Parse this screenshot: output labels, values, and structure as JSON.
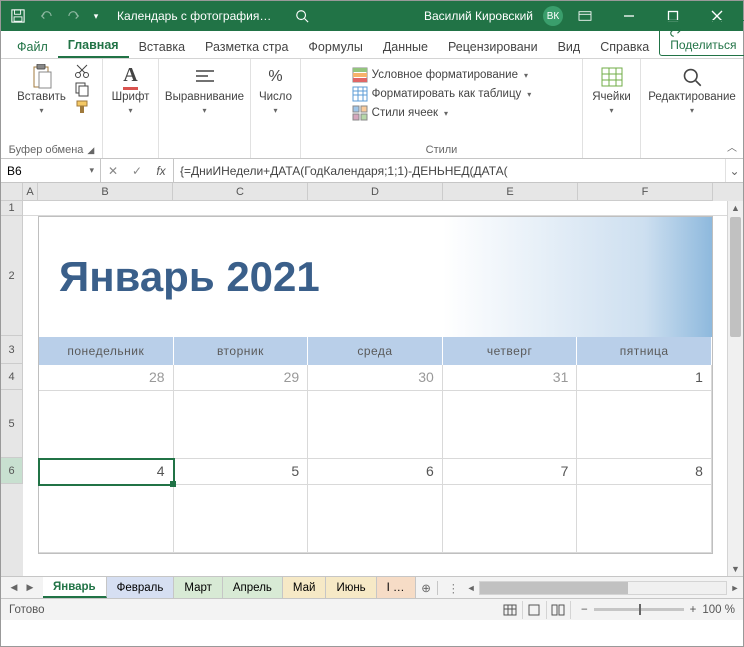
{
  "titlebar": {
    "doc_title": "Календарь с фотография…",
    "user_name": "Василий Кировский",
    "user_initials": "ВК"
  },
  "ribbon_tabs": {
    "file": "Файл",
    "home": "Главная",
    "insert": "Вставка",
    "layout": "Разметка стра",
    "formulas": "Формулы",
    "data": "Данные",
    "review": "Рецензировани",
    "view": "Вид",
    "help": "Справка",
    "share": "Поделиться"
  },
  "ribbon": {
    "clipboard": {
      "paste": "Вставить",
      "label": "Буфер обмена"
    },
    "font": {
      "label": "Шрифт"
    },
    "align": {
      "label": "Выравнивание"
    },
    "number": {
      "label": "Число"
    },
    "styles": {
      "cond": "Условное форматирование",
      "table": "Форматировать как таблицу",
      "cell": "Стили ячеек",
      "label": "Стили"
    },
    "cells": {
      "label": "Ячейки"
    },
    "editing": {
      "label": "Редактирование"
    }
  },
  "formula_bar": {
    "cell_ref": "B6",
    "formula": "{=ДниИНедели+ДАТА(ГодКалендаря;1;1)-ДЕНЬНЕД(ДАТА("
  },
  "columns": [
    "A",
    "B",
    "C",
    "D",
    "E",
    "F"
  ],
  "rows": [
    "1",
    "2",
    "3",
    "4",
    "5",
    "6"
  ],
  "calendar": {
    "title": "Январь 2021",
    "day_headers": [
      "понедельник",
      "вторник",
      "среда",
      "четверг",
      "пятница"
    ],
    "week1": [
      "28",
      "29",
      "30",
      "31",
      "1"
    ],
    "week2": [
      "4",
      "5",
      "6",
      "7",
      "8"
    ]
  },
  "sheet_tabs": {
    "items": [
      {
        "label": "Январь",
        "color": "#ffffff"
      },
      {
        "label": "Февраль",
        "color": "#d6dff2"
      },
      {
        "label": "Март",
        "color": "#d8ead5"
      },
      {
        "label": "Апрель",
        "color": "#d8ead5"
      },
      {
        "label": "Май",
        "color": "#f6e9c6"
      },
      {
        "label": "Июнь",
        "color": "#f6e9c6"
      },
      {
        "label": "І …",
        "color": "#f6dcc6"
      }
    ]
  },
  "statusbar": {
    "ready": "Готово",
    "zoom": "100 %"
  }
}
